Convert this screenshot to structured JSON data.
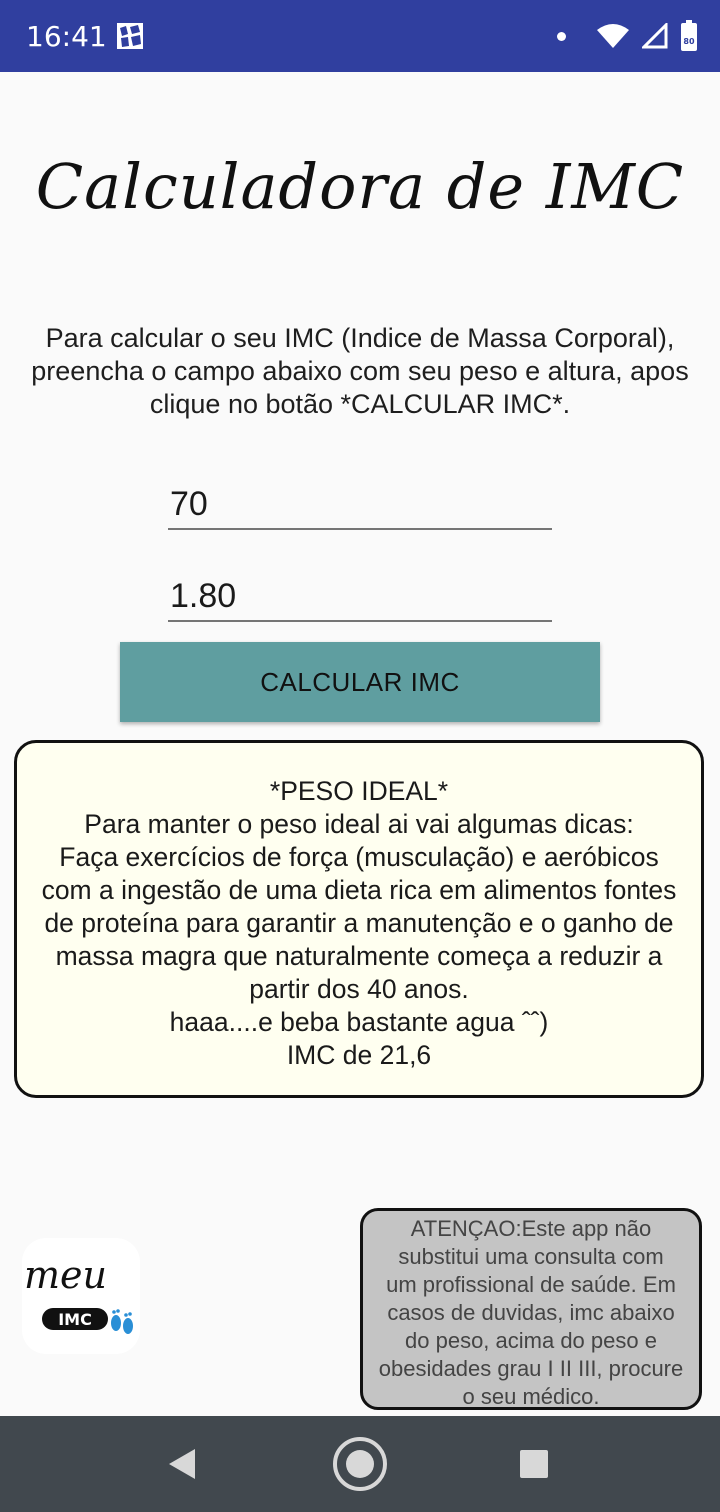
{
  "status_bar": {
    "time": "16:41",
    "battery_level": "80",
    "icons": [
      "app-notification-icon",
      "dot-icon",
      "wifi-icon",
      "signal-icon",
      "battery-icon"
    ]
  },
  "header": {
    "title": "Calculadora de IMC"
  },
  "instructions": {
    "lines": [
      "Para calcular o seu IMC (Indice de Massa Corporal),",
      "preencha o campo abaixo com seu peso e altura, apos",
      "clique no botão *CALCULAR IMC*."
    ]
  },
  "form": {
    "weight_value": "70",
    "height_value": "1.80",
    "calculate_label": "CALCULAR IMC"
  },
  "result": {
    "lines": [
      "*PESO IDEAL*",
      "Para manter o peso ideal ai vai algumas dicas:",
      "Faça exercícios de força (musculação) e aeróbicos",
      "com a ingestão de uma dieta rica em alimentos fontes",
      "de proteína para garantir a manutenção e o ganho de",
      "massa magra que naturalmente começa a reduzir a",
      "partir dos 40 anos.",
      "haaa....e beba bastante agua ˆˆ)",
      "IMC de 21,6"
    ]
  },
  "logo": {
    "text_top": "meu",
    "text_bottom": "IMC"
  },
  "warning": {
    "lines": [
      "ATENÇAO:Este app não",
      "substitui uma consulta com",
      "um profissional de saúde. Em",
      "casos de duvidas, imc abaixo",
      "do peso, acima do peso e",
      "obesidades grau I II III, procure",
      "o seu médico."
    ]
  },
  "colors": {
    "status_bar": "#303f9f",
    "button": "#5f9ea0",
    "result_background": "#fffff0",
    "warning_background": "#c4c4c4",
    "nav_bar": "#41484e"
  }
}
